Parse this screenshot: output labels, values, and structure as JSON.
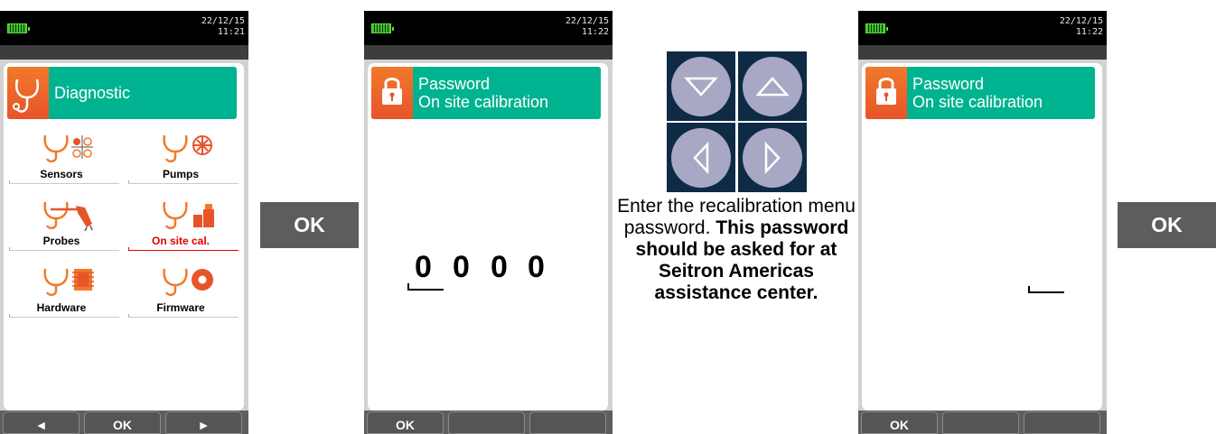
{
  "devices": [
    {
      "status": {
        "date": "22/12/15",
        "time": "11:21"
      },
      "title": "Diagnostic",
      "menu": [
        {
          "label": "Sensors"
        },
        {
          "label": "Pumps"
        },
        {
          "label": "Probes"
        },
        {
          "label": "On site cal.",
          "selected": true
        },
        {
          "label": "Hardware"
        },
        {
          "label": "Firmware"
        }
      ],
      "softkeys": {
        "left": "◄",
        "center": "OK",
        "right": "►"
      }
    },
    {
      "status": {
        "date": "22/12/15",
        "time": "11:22"
      },
      "title_line1": "Password",
      "title_line2": "On site calibration",
      "password_digits": [
        "0",
        "0",
        "0",
        "0"
      ],
      "softkeys": {
        "left": "OK",
        "center": "",
        "right": ""
      }
    },
    {
      "status": {
        "date": "22/12/15",
        "time": "11:22"
      },
      "title_line1": "Password",
      "title_line2": "On site calibration",
      "softkeys": {
        "left": "OK",
        "center": "",
        "right": ""
      }
    }
  ],
  "ok_buttons": {
    "first": "OK",
    "second": "OK"
  },
  "instruction": {
    "normal": "Enter the recalibration menu password.",
    "bold": "This password should be asked for at Seitron Americas assistance center."
  },
  "icons": {
    "nav": [
      "arrow-down-icon",
      "arrow-up-icon",
      "arrow-left-icon",
      "arrow-right-icon"
    ],
    "lock": "lock-icon",
    "stethoscope": "stethoscope-icon"
  },
  "colors": {
    "title_bar": "#00b390",
    "accent_orange": "#f07a2a",
    "selected_red": "#e00000"
  }
}
